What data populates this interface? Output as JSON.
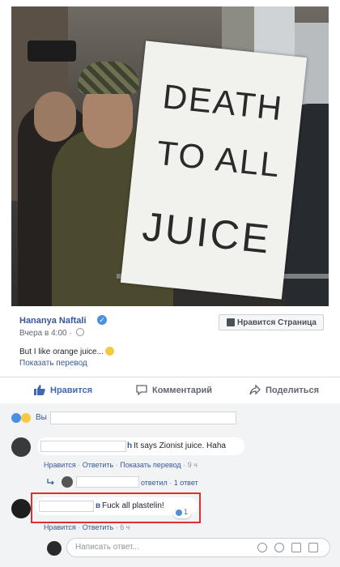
{
  "post": {
    "author": "Hananya Naftali",
    "time": "Вчера в 4:00",
    "dot": "·",
    "like_page": "Нравится Страница",
    "text": "But I like orange juice...",
    "translate": "Показать перевод",
    "sign_text": [
      "DEATH",
      "TO ALL",
      "JUICE"
    ]
  },
  "actions": {
    "like": "Нравится",
    "comment": "Комментарий",
    "share": "Поделиться"
  },
  "reactions": {
    "text": "Вы"
  },
  "comments": [
    {
      "name_suffix": "h",
      "text": "It says Zionist juice. Haha",
      "meta": {
        "like": "Нравится",
        "reply": "Ответить",
        "translate": "Показать перевод",
        "time": "9 ч",
        "sep": "·"
      }
    },
    {
      "name_suffix": "в",
      "text": "Fuck all plastelin!",
      "likes": "1",
      "meta": {
        "like": "Нравится",
        "reply": "Ответить",
        "time": "6 ч",
        "sep": "·"
      }
    }
  ],
  "reply_thread": {
    "replied": "ответил",
    "count": "1 ответ",
    "sep": "·"
  },
  "comment_input": {
    "placeholder": "Написать ответ..."
  },
  "colors": {
    "link": "#365899",
    "highlight": "#e02f2f",
    "like_blue": "#4a90e2"
  }
}
